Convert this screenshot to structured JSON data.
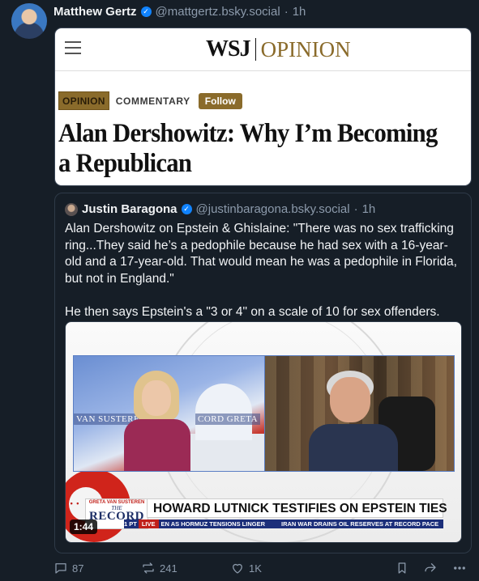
{
  "post": {
    "author_name": "Matthew Gertz",
    "handle": "@mattgertz.bsky.social",
    "separator": "·",
    "time": "1h"
  },
  "link_card": {
    "site_wsj": "WSJ",
    "site_section": "OPINION",
    "tag_opinion": "OPINION",
    "tag_commentary": "COMMENTARY",
    "follow_label": "Follow",
    "headline": "Alan Dershowitz: Why I’m Becoming a Republican"
  },
  "quote": {
    "author_name": "Justin Baragona",
    "handle": "@justinbaragona.bsky.social",
    "separator": "·",
    "time": "1h",
    "text": "Alan Dershowitz on Epstein & Ghislaine: \"There was no sex trafficking ring...They said he’s a pedophile because he had sex with a 16-year-old and a 17-year-old. That would mean he was a pedophile in Florida, but not in England.\"\n\nHe then says Epstein's a \"3 or 4\" on a scale of 10 for sex offenders.",
    "video": {
      "banner_left": "VAN SUSTEREN",
      "banner_right": "CORD  GRETA",
      "brand_top": "GRETA VAN SUSTEREN",
      "brand_the": "THE",
      "brand_record": "RECORD",
      "chyron": "HOWARD LUTNICK TESTIFIES ON EPSTEIN TIES",
      "ticker_pt": "1 PT",
      "ticker_live": "LIVE",
      "ticker_items": [
        "EN AS HORMUZ TENSIONS LINGER",
        "IRAN WAR DRAINS OIL RESERVES AT RECORD PACE"
      ],
      "duration": "1:44",
      "dots": "• • •"
    }
  },
  "actions": {
    "replies": "87",
    "reposts": "241",
    "likes": "1K"
  },
  "colors": {
    "background": "#161e27",
    "accent_blue": "#1083fe",
    "wsj_gold": "#8a6b2b",
    "muted": "#8c9aab"
  },
  "icons": [
    "reply-icon",
    "repost-icon",
    "like-icon",
    "bookmark-icon",
    "share-icon",
    "more-icon",
    "verified-icon",
    "menu-icon"
  ]
}
